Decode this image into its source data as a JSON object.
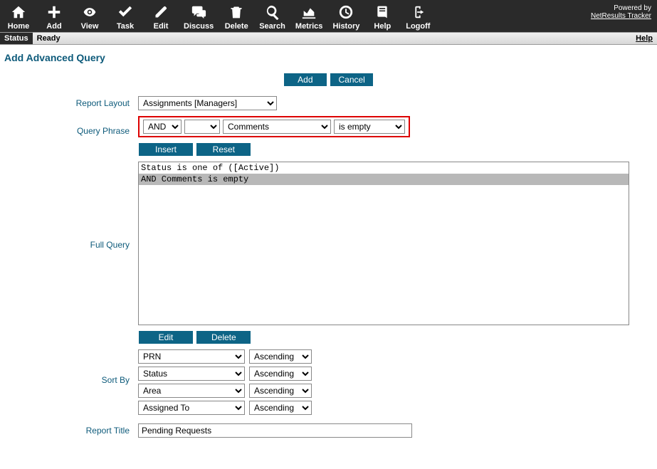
{
  "toolbar": {
    "home": "Home",
    "add": "Add",
    "view": "View",
    "task": "Task",
    "edit": "Edit",
    "discuss": "Discuss",
    "delete": "Delete",
    "search": "Search",
    "metrics": "Metrics",
    "history": "History",
    "help": "Help",
    "logoff": "Logoff",
    "powered_by": "Powered by",
    "product": "NetResults Tracker"
  },
  "status": {
    "label": "Status",
    "value": "Ready",
    "help": "Help"
  },
  "page": {
    "title": "Add Advanced Query"
  },
  "buttons": {
    "add": "Add",
    "cancel": "Cancel",
    "insert": "Insert",
    "reset": "Reset",
    "edit": "Edit",
    "delete": "Delete"
  },
  "labels": {
    "report_layout": "Report Layout",
    "query_phrase": "Query Phrase",
    "full_query": "Full Query",
    "sort_by": "Sort By",
    "report_title": "Report Title"
  },
  "form": {
    "report_layout": "Assignments [Managers]",
    "phrase_op": "AND",
    "phrase_sub": "",
    "phrase_field": "Comments",
    "phrase_cond": "is empty",
    "query_lines": [
      "Status is one of ([Active])",
      "AND Comments is empty"
    ],
    "selected_line": 1,
    "sort": [
      {
        "field": "PRN",
        "dir": "Ascending"
      },
      {
        "field": "Status",
        "dir": "Ascending"
      },
      {
        "field": "Area",
        "dir": "Ascending"
      },
      {
        "field": "Assigned To",
        "dir": "Ascending"
      }
    ],
    "report_title": "Pending Requests"
  }
}
